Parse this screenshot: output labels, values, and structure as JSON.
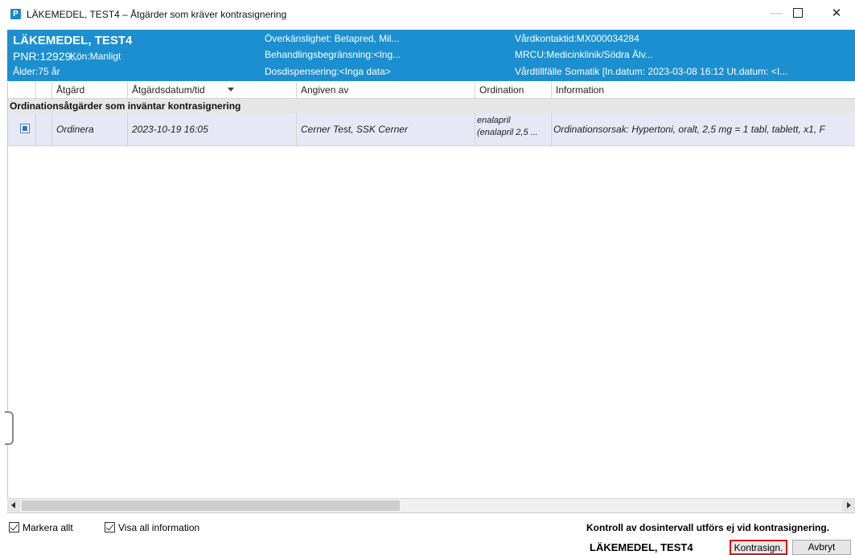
{
  "window": {
    "icon_letter": "P",
    "title": "LÄKEMEDEL, TEST4 – Åtgärder som kräver kontrasignering",
    "min_glyph": "—",
    "close_glyph": "✕"
  },
  "patient": {
    "name": "LÄKEMEDEL, TEST4",
    "pnr": "PNR:12929...",
    "kon": "Kön:Manligt",
    "age": "Ålder:75 år",
    "overkanslighet": "Överkänslighet: Betapred, Mil...",
    "behandlingsbegransning": "Behandlingsbegränsning:<Ing...",
    "dosdispensering": "Dosdispensering:<Inga data>",
    "vardkontakt": "Vårdkontaktid:MX000034284",
    "mrcu": "MRCU:Medicinklinik/Södra Älv...",
    "vardtillfalle": "Vårdtillfälle Somatik [In.datum: 2023-03-08 16:12 Ut.datum: <I..."
  },
  "grid": {
    "columns": [
      "",
      "",
      "Åtgärd",
      "Åtgärdsdatum/tid",
      "Angiven av",
      "Ordination",
      "Information"
    ],
    "group_label": "Ordinationsåtgärder som inväntar kontrasignering",
    "rows": [
      {
        "checked": true,
        "atgard": "Ordinera",
        "datum": "2023-10-19 16:05",
        "angiven_av": "Cerner Test, SSK Cerner",
        "ordination_line1": "enalapril",
        "ordination_line2": "(enalapril 2,5 ...",
        "information": "Ordinationsorsak: Hypertoni, oralt, 2,5 mg = 1 tabl, tablett, x1, F"
      }
    ]
  },
  "footer": {
    "markera_allt": "Markera allt",
    "visa_all_information": "Visa all information",
    "note": "Kontroll av dosintervall utförs ej vid kontrasignering.",
    "patient_name": "LÄKEMEDEL, TEST4",
    "kontrasign_label": "Kontrasign.",
    "avbryt_label": "Avbryt"
  },
  "colors": {
    "header_bg": "#1c8fd0",
    "row_bg": "#e6e8f5",
    "group_bg": "#e6e6e6",
    "highlight_border": "#dd1111"
  }
}
